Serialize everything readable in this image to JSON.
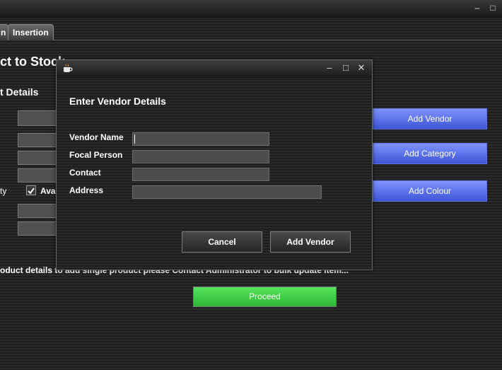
{
  "window": {
    "minimize_icon": "–",
    "maximize_icon": "□"
  },
  "tabs": [
    {
      "label": "n"
    },
    {
      "label": "Insertion"
    }
  ],
  "page": {
    "title": "ct to Stock",
    "section_title": "t Details",
    "quantity_label_fragment": "ty",
    "available_label_fragment": "Ava",
    "note": "oduct details to add single product please Contact Administrator to bulk update item..."
  },
  "side_buttons": {
    "add_vendor": "Add Vendor",
    "add_category": "Add Category",
    "add_colour": "Add Colour"
  },
  "proceed_label": "Proceed",
  "dialog": {
    "app_icon": "coffee-cup-icon",
    "heading": "Enter Vendor Details",
    "fields": [
      {
        "label": "Vendor Name",
        "value": ""
      },
      {
        "label": "Focal Person",
        "value": ""
      },
      {
        "label": "Contact",
        "value": ""
      },
      {
        "label": "Address",
        "value": ""
      }
    ],
    "cancel_label": "Cancel",
    "submit_label": "Add Vendor",
    "controls": {
      "minimize": "–",
      "maximize": "□",
      "close": "✕"
    }
  },
  "colors": {
    "blue_button": "#5b70e8",
    "proceed_button": "#3fc945",
    "background": "#262626"
  }
}
